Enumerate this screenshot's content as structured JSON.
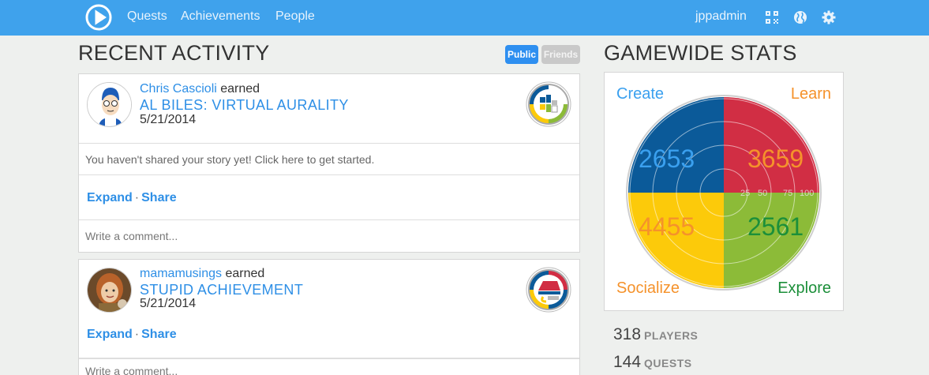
{
  "nav": {
    "links": [
      "Quests",
      "Achievements",
      "People"
    ],
    "user": "jppadmin",
    "icons": [
      "qr-code-icon",
      "globe-icon",
      "gear-icon"
    ]
  },
  "activity": {
    "title": "RECENT ACTIVITY",
    "filter_public": "Public",
    "filter_friends": "Friends",
    "items": [
      {
        "user": "Chris Cascioli",
        "verb": "earned",
        "achievement": "AL BILES: VIRTUAL AURALITY",
        "date": "5/21/2014",
        "story_prompt": "You haven't shared your story yet! Click here to get started.",
        "expand": "Expand",
        "share": "Share",
        "comment_placeholder": "Write a comment..."
      },
      {
        "user": "mamamusings",
        "verb": "earned",
        "achievement": "STUPID ACHIEVEMENT",
        "date": "5/21/2014",
        "expand": "Expand",
        "share": "Share",
        "comment_placeholder": "Write a comment..."
      }
    ]
  },
  "stats": {
    "title": "GAMEWIDE STATS",
    "quadrants": {
      "create": {
        "label": "Create",
        "value": "2653",
        "color": "#0b5a99"
      },
      "learn": {
        "label": "Learn",
        "value": "3659",
        "color": "#d12e44"
      },
      "socialize": {
        "label": "Socialize",
        "value": "4455",
        "color": "#fcca0a"
      },
      "explore": {
        "label": "Explore",
        "value": "2561",
        "color": "#8cbb38"
      }
    },
    "rings": [
      "25",
      "50",
      "75",
      "100"
    ],
    "players": {
      "count": "318",
      "label": "PLAYERS"
    },
    "quests": {
      "count": "144",
      "label": "QUESTS"
    }
  },
  "colors": {
    "nav": "#3fa2ec",
    "link": "#2e8fe6",
    "orange": "#f5922b",
    "green": "#1c8f3a"
  }
}
